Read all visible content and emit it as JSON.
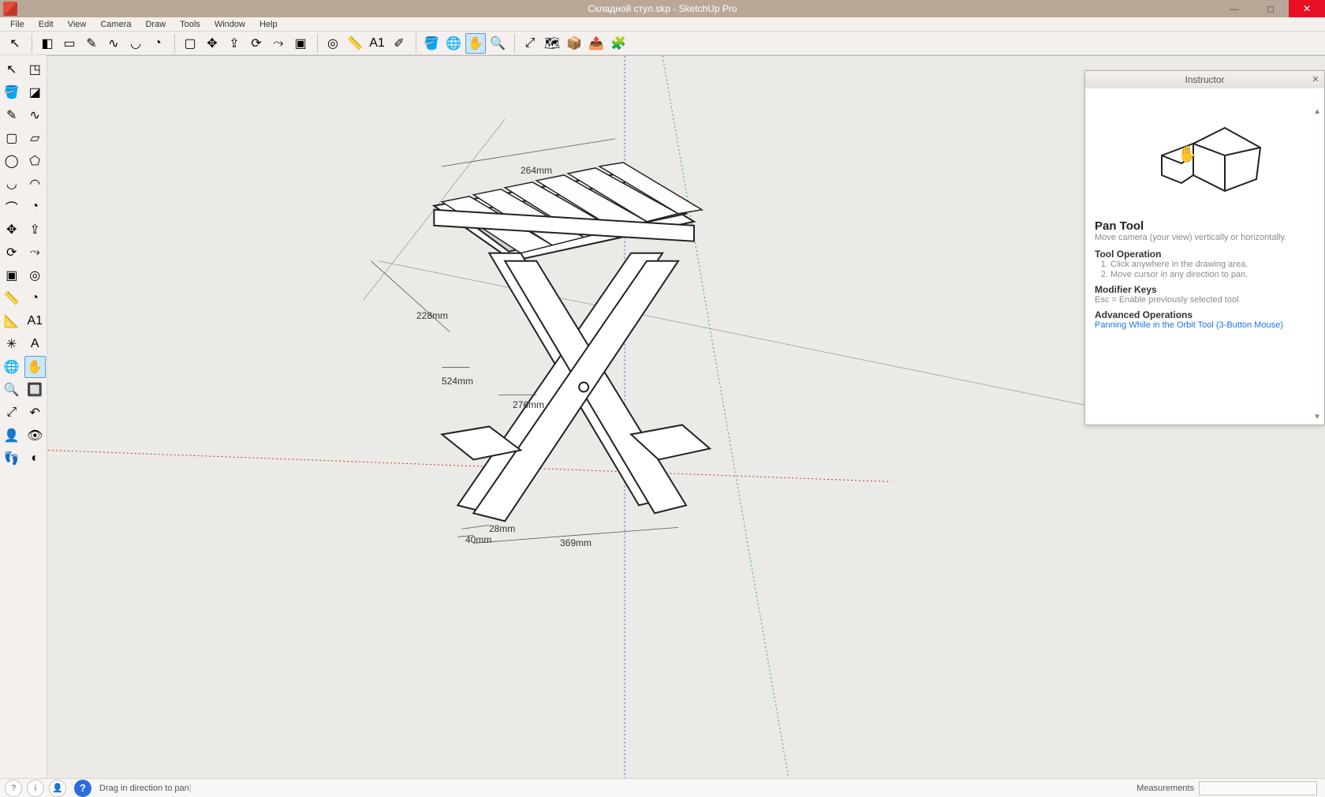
{
  "titlebar": {
    "title": "Складной стул.skp - SketchUp Pro"
  },
  "menu": [
    "File",
    "Edit",
    "View",
    "Camera",
    "Draw",
    "Tools",
    "Window",
    "Help"
  ],
  "topToolbar": [
    {
      "name": "select-arrow-icon",
      "glyph": "↖",
      "sep": false
    },
    {
      "name": "eraser-icon",
      "glyph": "◧",
      "sep": true
    },
    {
      "name": "edge-style-icon",
      "glyph": "▭"
    },
    {
      "name": "line-icon",
      "glyph": "✎"
    },
    {
      "name": "freehand-icon",
      "glyph": "∿"
    },
    {
      "name": "arc-icon",
      "glyph": "◡"
    },
    {
      "name": "pie-icon",
      "glyph": "◔"
    },
    {
      "name": "rectangle-icon",
      "glyph": "▢",
      "sep": true
    },
    {
      "name": "move-icon",
      "glyph": "✥"
    },
    {
      "name": "pushpull-icon",
      "glyph": "⇪"
    },
    {
      "name": "rotate-icon",
      "glyph": "⟳"
    },
    {
      "name": "followme-icon",
      "glyph": "⤳"
    },
    {
      "name": "scale-icon",
      "glyph": "▣"
    },
    {
      "name": "offset-icon",
      "glyph": "◎",
      "sep": true
    },
    {
      "name": "tape-icon",
      "glyph": "📏"
    },
    {
      "name": "dimension-icon",
      "glyph": "A1"
    },
    {
      "name": "text-icon",
      "glyph": "✐"
    },
    {
      "name": "paint-icon",
      "glyph": "🪣",
      "sep": true
    },
    {
      "name": "orbit-icon",
      "glyph": "🌐"
    },
    {
      "name": "pan-icon",
      "glyph": "✋",
      "active": true
    },
    {
      "name": "zoom-icon",
      "glyph": "🔍"
    },
    {
      "name": "zoom-extents-icon",
      "glyph": "⤢",
      "sep": true
    },
    {
      "name": "addlocation-icon",
      "glyph": "🗺"
    },
    {
      "name": "getmodels-icon",
      "glyph": "📦"
    },
    {
      "name": "share-icon",
      "glyph": "📤"
    },
    {
      "name": "extension-icon",
      "glyph": "🧩"
    }
  ],
  "leftToolbar": [
    [
      {
        "n": "select-icon",
        "g": "↖"
      },
      {
        "n": "makecomp-icon",
        "g": "◳"
      }
    ],
    [
      {
        "n": "paintbucket-icon",
        "g": "🪣"
      },
      {
        "n": "eraser2-icon",
        "g": "◪"
      }
    ],
    [
      {
        "n": "line2-icon",
        "g": "✎"
      },
      {
        "n": "freehand2-icon",
        "g": "∿"
      }
    ],
    [
      {
        "n": "rectangle2-icon",
        "g": "▢"
      },
      {
        "n": "rotated-rect-icon",
        "g": "▱"
      }
    ],
    [
      {
        "n": "circle-icon",
        "g": "◯"
      },
      {
        "n": "polygon-icon",
        "g": "⬠"
      }
    ],
    [
      {
        "n": "arc2-icon",
        "g": "◡"
      },
      {
        "n": "twoarc-icon",
        "g": "◠"
      }
    ],
    [
      {
        "n": "threearc-icon",
        "g": "⌒"
      },
      {
        "n": "pie2-icon",
        "g": "◔"
      }
    ],
    [
      {
        "n": "move2-icon",
        "g": "✥"
      },
      {
        "n": "pushpull2-icon",
        "g": "⇪"
      }
    ],
    [
      {
        "n": "rotate2-icon",
        "g": "⟳"
      },
      {
        "n": "followme2-icon",
        "g": "⤳"
      }
    ],
    [
      {
        "n": "scale2-icon",
        "g": "▣"
      },
      {
        "n": "offset2-icon",
        "g": "◎"
      }
    ],
    [
      {
        "n": "tape2-icon",
        "g": "📏"
      },
      {
        "n": "protractor-icon",
        "g": "◔"
      }
    ],
    [
      {
        "n": "dimension2-icon",
        "g": "📐"
      },
      {
        "n": "text2-icon",
        "g": "A1"
      }
    ],
    [
      {
        "n": "axes-icon",
        "g": "✳"
      },
      {
        "n": "3dtext-icon",
        "g": "A"
      }
    ],
    [
      {
        "n": "orbit2-icon",
        "g": "🌐"
      },
      {
        "n": "pan2-icon",
        "g": "✋",
        "active": true
      }
    ],
    [
      {
        "n": "zoom2-icon",
        "g": "🔍"
      },
      {
        "n": "zoomwin-icon",
        "g": "🔲"
      }
    ],
    [
      {
        "n": "zoomext2-icon",
        "g": "⤢"
      },
      {
        "n": "previous-icon",
        "g": "↶"
      }
    ],
    [
      {
        "n": "position-camera-icon",
        "g": "👤"
      },
      {
        "n": "lookaround-icon",
        "g": "👁"
      }
    ],
    [
      {
        "n": "walk-icon",
        "g": "👣"
      },
      {
        "n": "section-icon",
        "g": "◐"
      }
    ]
  ],
  "canvas": {
    "dimensions": {
      "d1": "264mm",
      "d2": "228mm",
      "d3": "524mm",
      "d4": "276mm",
      "d5": "369mm",
      "d6": "28mm",
      "d7": "40mm"
    }
  },
  "instructor": {
    "title": "Instructor",
    "tool_name": "Pan Tool",
    "tool_desc": "Move camera (your view) vertically or horizontally.",
    "op_header": "Tool Operation",
    "ops": [
      "Click anywhere in the drawing area.",
      "Move cursor in any direction to pan."
    ],
    "mod_header": "Modifier Keys",
    "mod_text": "Esc = Enable previously selected tool",
    "adv_header": "Advanced Operations",
    "adv_link": "Panning While in the Orbit Tool (3-Button Mouse)"
  },
  "status": {
    "tip": "Drag in direction to pan",
    "meas_label": "Measurements"
  }
}
